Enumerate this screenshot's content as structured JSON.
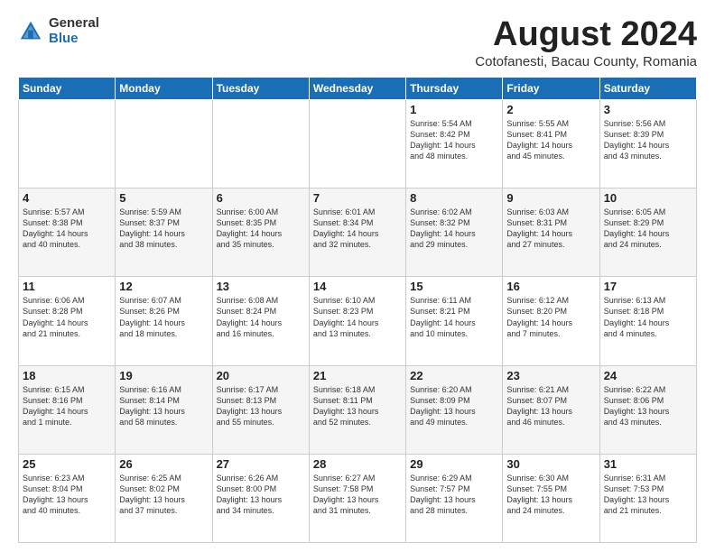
{
  "logo": {
    "general": "General",
    "blue": "Blue"
  },
  "header": {
    "title": "August 2024",
    "subtitle": "Cotofanesti, Bacau County, Romania"
  },
  "weekdays": [
    "Sunday",
    "Monday",
    "Tuesday",
    "Wednesday",
    "Thursday",
    "Friday",
    "Saturday"
  ],
  "weeks": [
    [
      {
        "day": "",
        "info": ""
      },
      {
        "day": "",
        "info": ""
      },
      {
        "day": "",
        "info": ""
      },
      {
        "day": "",
        "info": ""
      },
      {
        "day": "1",
        "info": "Sunrise: 5:54 AM\nSunset: 8:42 PM\nDaylight: 14 hours\nand 48 minutes."
      },
      {
        "day": "2",
        "info": "Sunrise: 5:55 AM\nSunset: 8:41 PM\nDaylight: 14 hours\nand 45 minutes."
      },
      {
        "day": "3",
        "info": "Sunrise: 5:56 AM\nSunset: 8:39 PM\nDaylight: 14 hours\nand 43 minutes."
      }
    ],
    [
      {
        "day": "4",
        "info": "Sunrise: 5:57 AM\nSunset: 8:38 PM\nDaylight: 14 hours\nand 40 minutes."
      },
      {
        "day": "5",
        "info": "Sunrise: 5:59 AM\nSunset: 8:37 PM\nDaylight: 14 hours\nand 38 minutes."
      },
      {
        "day": "6",
        "info": "Sunrise: 6:00 AM\nSunset: 8:35 PM\nDaylight: 14 hours\nand 35 minutes."
      },
      {
        "day": "7",
        "info": "Sunrise: 6:01 AM\nSunset: 8:34 PM\nDaylight: 14 hours\nand 32 minutes."
      },
      {
        "day": "8",
        "info": "Sunrise: 6:02 AM\nSunset: 8:32 PM\nDaylight: 14 hours\nand 29 minutes."
      },
      {
        "day": "9",
        "info": "Sunrise: 6:03 AM\nSunset: 8:31 PM\nDaylight: 14 hours\nand 27 minutes."
      },
      {
        "day": "10",
        "info": "Sunrise: 6:05 AM\nSunset: 8:29 PM\nDaylight: 14 hours\nand 24 minutes."
      }
    ],
    [
      {
        "day": "11",
        "info": "Sunrise: 6:06 AM\nSunset: 8:28 PM\nDaylight: 14 hours\nand 21 minutes."
      },
      {
        "day": "12",
        "info": "Sunrise: 6:07 AM\nSunset: 8:26 PM\nDaylight: 14 hours\nand 18 minutes."
      },
      {
        "day": "13",
        "info": "Sunrise: 6:08 AM\nSunset: 8:24 PM\nDaylight: 14 hours\nand 16 minutes."
      },
      {
        "day": "14",
        "info": "Sunrise: 6:10 AM\nSunset: 8:23 PM\nDaylight: 14 hours\nand 13 minutes."
      },
      {
        "day": "15",
        "info": "Sunrise: 6:11 AM\nSunset: 8:21 PM\nDaylight: 14 hours\nand 10 minutes."
      },
      {
        "day": "16",
        "info": "Sunrise: 6:12 AM\nSunset: 8:20 PM\nDaylight: 14 hours\nand 7 minutes."
      },
      {
        "day": "17",
        "info": "Sunrise: 6:13 AM\nSunset: 8:18 PM\nDaylight: 14 hours\nand 4 minutes."
      }
    ],
    [
      {
        "day": "18",
        "info": "Sunrise: 6:15 AM\nSunset: 8:16 PM\nDaylight: 14 hours\nand 1 minute."
      },
      {
        "day": "19",
        "info": "Sunrise: 6:16 AM\nSunset: 8:14 PM\nDaylight: 13 hours\nand 58 minutes."
      },
      {
        "day": "20",
        "info": "Sunrise: 6:17 AM\nSunset: 8:13 PM\nDaylight: 13 hours\nand 55 minutes."
      },
      {
        "day": "21",
        "info": "Sunrise: 6:18 AM\nSunset: 8:11 PM\nDaylight: 13 hours\nand 52 minutes."
      },
      {
        "day": "22",
        "info": "Sunrise: 6:20 AM\nSunset: 8:09 PM\nDaylight: 13 hours\nand 49 minutes."
      },
      {
        "day": "23",
        "info": "Sunrise: 6:21 AM\nSunset: 8:07 PM\nDaylight: 13 hours\nand 46 minutes."
      },
      {
        "day": "24",
        "info": "Sunrise: 6:22 AM\nSunset: 8:06 PM\nDaylight: 13 hours\nand 43 minutes."
      }
    ],
    [
      {
        "day": "25",
        "info": "Sunrise: 6:23 AM\nSunset: 8:04 PM\nDaylight: 13 hours\nand 40 minutes."
      },
      {
        "day": "26",
        "info": "Sunrise: 6:25 AM\nSunset: 8:02 PM\nDaylight: 13 hours\nand 37 minutes."
      },
      {
        "day": "27",
        "info": "Sunrise: 6:26 AM\nSunset: 8:00 PM\nDaylight: 13 hours\nand 34 minutes."
      },
      {
        "day": "28",
        "info": "Sunrise: 6:27 AM\nSunset: 7:58 PM\nDaylight: 13 hours\nand 31 minutes."
      },
      {
        "day": "29",
        "info": "Sunrise: 6:29 AM\nSunset: 7:57 PM\nDaylight: 13 hours\nand 28 minutes."
      },
      {
        "day": "30",
        "info": "Sunrise: 6:30 AM\nSunset: 7:55 PM\nDaylight: 13 hours\nand 24 minutes."
      },
      {
        "day": "31",
        "info": "Sunrise: 6:31 AM\nSunset: 7:53 PM\nDaylight: 13 hours\nand 21 minutes."
      }
    ]
  ]
}
